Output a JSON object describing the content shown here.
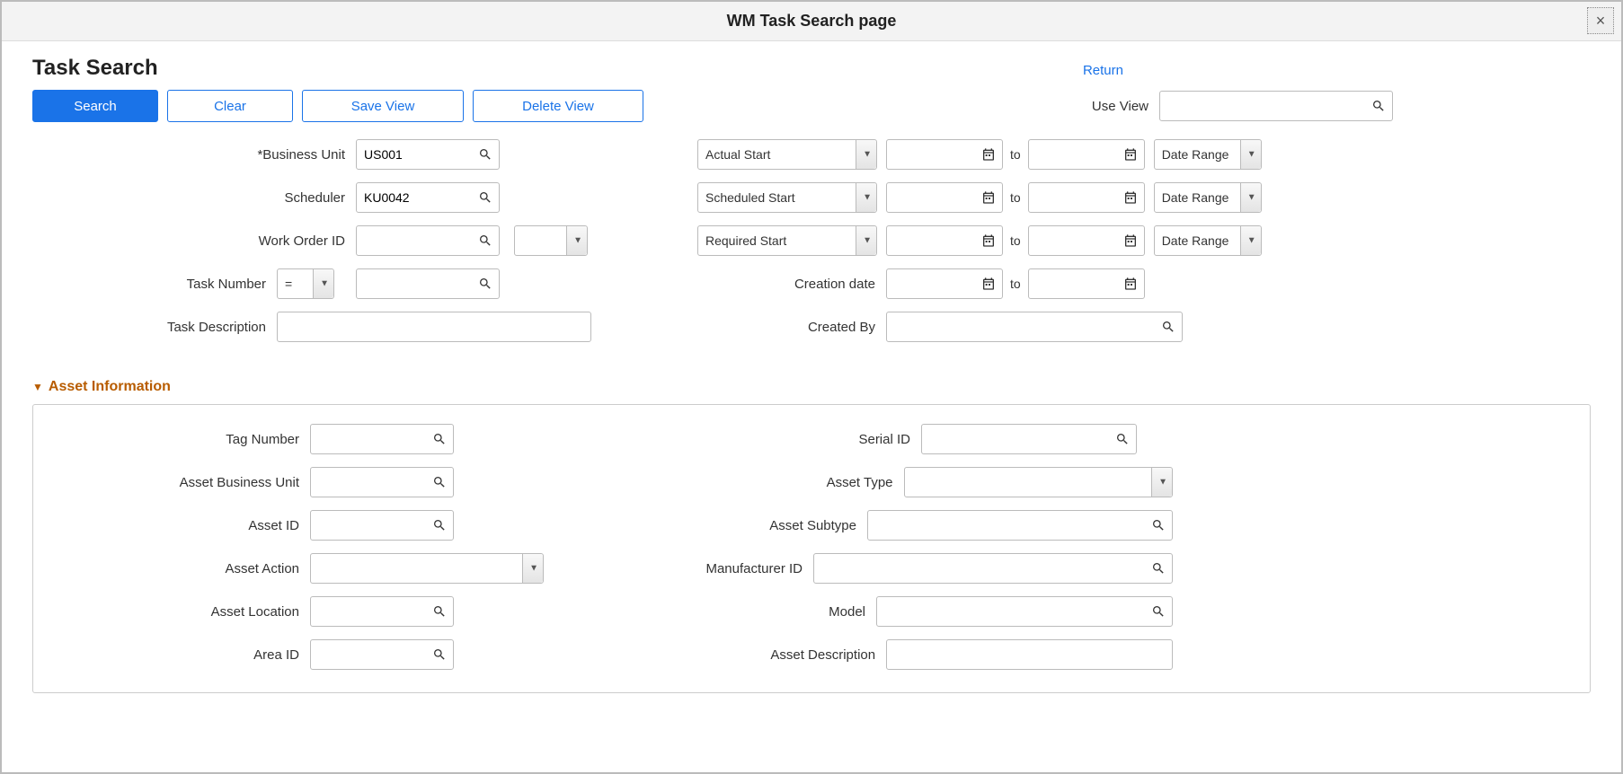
{
  "window": {
    "title": "WM Task Search page",
    "close_label": "×"
  },
  "header": {
    "page_title": "Task Search",
    "return_link": "Return"
  },
  "toolbar": {
    "search": "Search",
    "clear": "Clear",
    "save_view": "Save View",
    "delete_view": "Delete View",
    "use_view_label": "Use View",
    "use_view_value": ""
  },
  "left": {
    "business_unit_label": "*Business Unit",
    "business_unit_value": "US001",
    "scheduler_label": "Scheduler",
    "scheduler_value": "KU0042",
    "work_order_id_label": "Work Order ID",
    "work_order_id_value": "",
    "work_order_aux_value": "",
    "task_number_label": "Task Number",
    "task_number_op": "=",
    "task_number_value": "",
    "task_description_label": "Task Description",
    "task_description_value": ""
  },
  "right": {
    "actual_start_label": "Actual Start",
    "scheduled_start_label": "Scheduled Start",
    "required_start_label": "Required Start",
    "date_range_label": "Date Range",
    "to_label": "to",
    "creation_date_label": "Creation date",
    "created_by_label": "Created By",
    "created_by_value": ""
  },
  "asset": {
    "section_title": "Asset Information",
    "tag_number_label": "Tag Number",
    "asset_bu_label": "Asset Business Unit",
    "asset_id_label": "Asset ID",
    "asset_action_label": "Asset Action",
    "asset_location_label": "Asset Location",
    "area_id_label": "Area ID",
    "serial_id_label": "Serial ID",
    "asset_type_label": "Asset Type",
    "asset_subtype_label": "Asset Subtype",
    "manufacturer_id_label": "Manufacturer ID",
    "model_label": "Model",
    "asset_description_label": "Asset Description"
  }
}
